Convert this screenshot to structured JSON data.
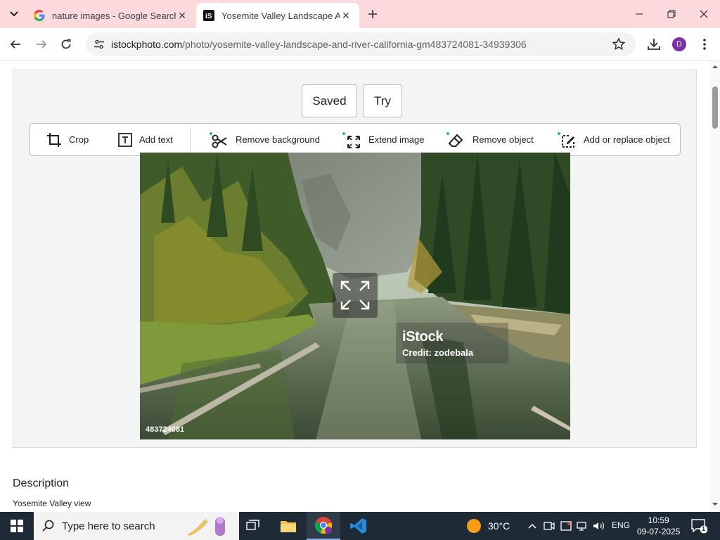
{
  "browser": {
    "tabs": [
      {
        "title": "nature images - Google Search",
        "favicon": "google-icon",
        "active": false
      },
      {
        "title": "Yosemite Valley Landscape And",
        "favicon": "istock-icon",
        "active": true
      }
    ],
    "url_host": "istockphoto.com",
    "url_path": "/photo/yosemite-valley-landscape-and-river-california-gm483724081-34939306",
    "profile_initial": "D"
  },
  "editor": {
    "saved_label": "Saved",
    "try_label": "Try",
    "tools": [
      {
        "label": "Crop",
        "icon": "crop-icon"
      },
      {
        "label": "Add text",
        "icon": "text-icon"
      },
      {
        "label": "Remove background",
        "icon": "scissors-icon"
      },
      {
        "label": "Extend image",
        "icon": "extend-icon"
      },
      {
        "label": "Remove object",
        "icon": "eraser-icon"
      },
      {
        "label": "Add or replace object",
        "icon": "edit-image-icon"
      }
    ]
  },
  "image": {
    "watermark_logo": "iStock",
    "credit": "Credit: zodebala",
    "image_id": "483724081"
  },
  "description": {
    "heading": "Description",
    "text": "Yosemite Valley view"
  },
  "taskbar": {
    "search_placeholder": "Type here to search",
    "temperature": "30°C",
    "language": "ENG",
    "time": "10:59",
    "date": "09-07-2025",
    "notification_count": "1"
  }
}
